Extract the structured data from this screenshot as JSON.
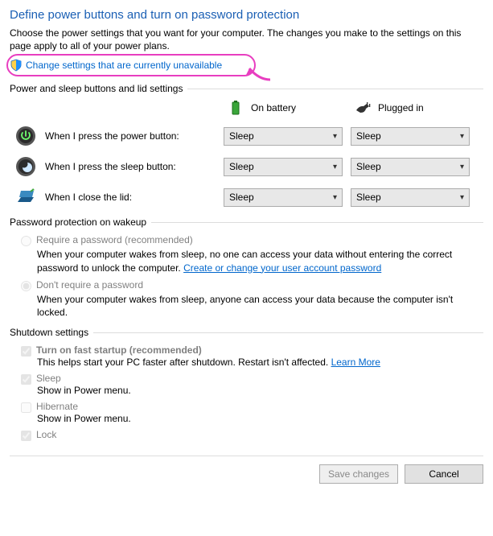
{
  "title": "Define power buttons and turn on password protection",
  "subtitle": "Choose the power settings that you want for your computer. The changes you make to the settings on this page apply to all of your power plans.",
  "change_link": "Change settings that are currently unavailable",
  "sections": {
    "buttons_head": "Power and sleep buttons and lid settings",
    "pwd_head": "Password protection on wakeup",
    "shutdown_head": "Shutdown settings"
  },
  "columns": {
    "battery": "On battery",
    "plugged": "Plugged in"
  },
  "rows": {
    "power": {
      "label": "When I press the power button:",
      "battery": "Sleep",
      "plugged": "Sleep"
    },
    "sleep": {
      "label": "When I press the sleep button:",
      "battery": "Sleep",
      "plugged": "Sleep"
    },
    "lid": {
      "label": "When I close the lid:",
      "battery": "Sleep",
      "plugged": "Sleep"
    }
  },
  "pwd": {
    "opt1": "Require a password (recommended)",
    "desc1a": "When your computer wakes from sleep, no one can access your data without entering the correct password to unlock the computer. ",
    "desc1_link": "Create or change your user account password",
    "opt2": "Don't require a password",
    "desc2": "When your computer wakes from sleep, anyone can access your data because the computer isn't locked."
  },
  "shutdown": {
    "faststart": "Turn on fast startup (recommended)",
    "faststart_desc": "This helps start your PC faster after shutdown. Restart isn't affected. ",
    "learn_more": "Learn More",
    "sleep": "Sleep",
    "sleep_desc": "Show in Power menu.",
    "hibernate": "Hibernate",
    "hibernate_desc": "Show in Power menu.",
    "lock": "Lock"
  },
  "buttons": {
    "save": "Save changes",
    "cancel": "Cancel"
  }
}
